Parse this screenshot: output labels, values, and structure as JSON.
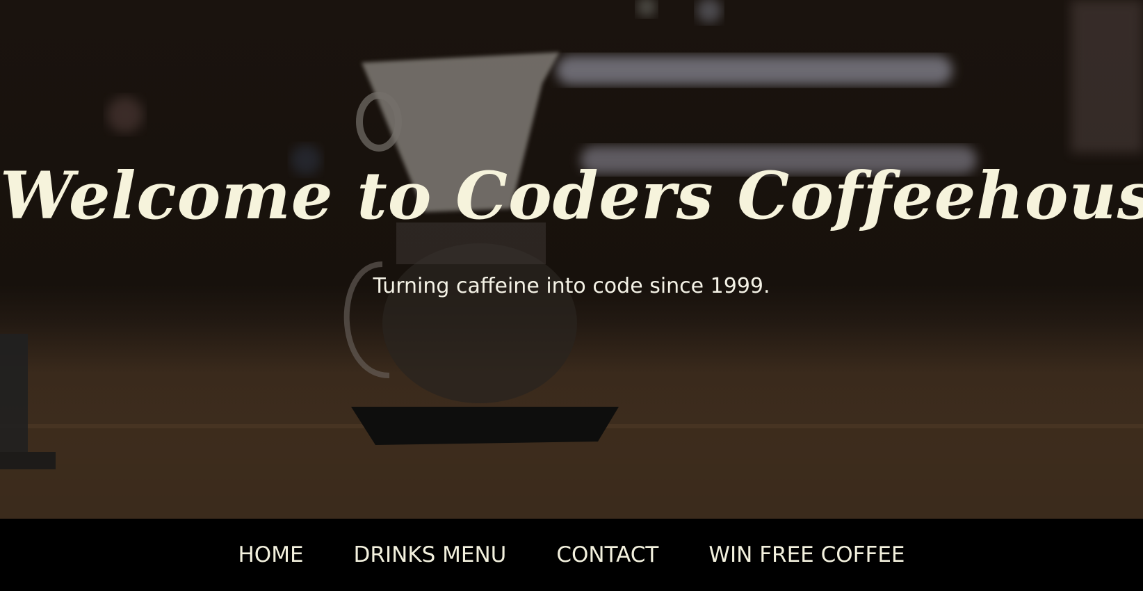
{
  "hero": {
    "headline": "Welcome to Coders Coffeehouse!",
    "tagline": "Turning caffeine into code since 1999."
  },
  "nav": {
    "items": [
      {
        "label": "HOME"
      },
      {
        "label": "DRINKS MENU"
      },
      {
        "label": "CONTACT"
      },
      {
        "label": "WIN FREE COFFEE"
      }
    ]
  },
  "colors": {
    "text_cream": "#f6f3dc",
    "nav_background": "#000000",
    "hero_overlay": "#17110c"
  }
}
